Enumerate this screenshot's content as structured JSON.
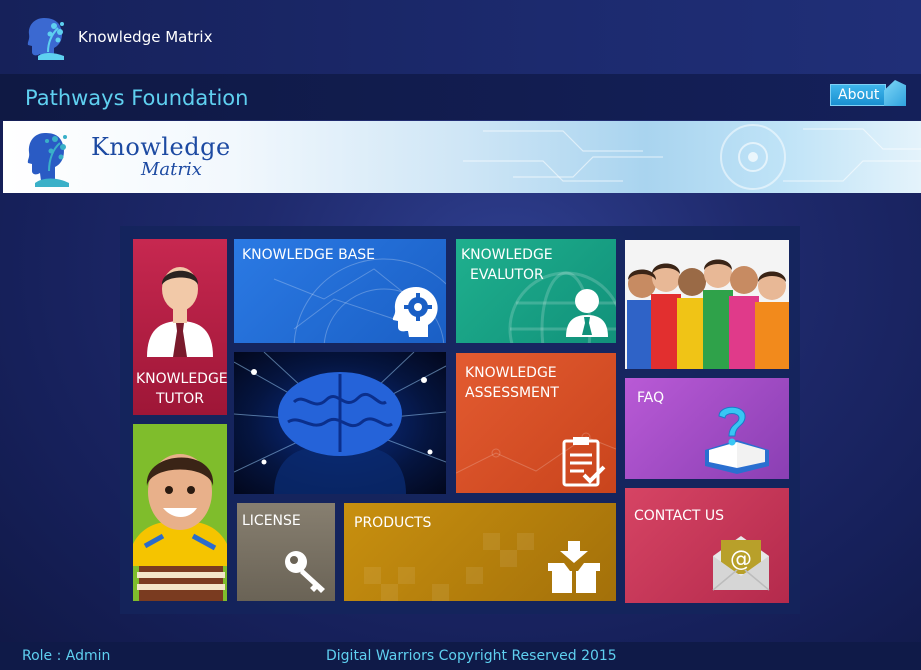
{
  "window": {
    "app_title": "Knowledge Matrix"
  },
  "header": {
    "org_name": "Pathways Foundation",
    "about_label": "About"
  },
  "banner": {
    "logo_word1": "Knowledge",
    "logo_word2": "Matrix"
  },
  "tiles": {
    "tutor": {
      "label_line1": "KNOWLEDGE",
      "label_line2": "TUTOR"
    },
    "base": {
      "label": "KNOWLEDGE BASE"
    },
    "evaluator": {
      "label_line1": "KNOWLEDGE",
      "label_line2": "EVALUTOR"
    },
    "assessment": {
      "label_line1": "KNOWLEDGE",
      "label_line2": "ASSESSMENT"
    },
    "license": {
      "label": "LICENSE"
    },
    "products": {
      "label": "PRODUCTS"
    },
    "faq": {
      "label": "FAQ"
    },
    "contact": {
      "label": "CONTACT US"
    }
  },
  "footer": {
    "role": "Role : Admin",
    "copyright": "Digital Warriors Copyright Reserved 2015"
  },
  "icons": {
    "app_logo": "head-tree-logo-icon",
    "base": "head-gear-icon",
    "evaluator": "person-icon",
    "assessment": "clipboard-check-icon",
    "license": "key-icon",
    "products": "box-download-icon",
    "faq": "question-book-icon",
    "contact": "envelope-at-icon"
  },
  "colors": {
    "accent_text": "#5fd0f0",
    "tutor": "#c72850",
    "base": "#2b7ae4",
    "evaluator": "#1fb08e",
    "assessment": "#e35b31",
    "license": "#877f70",
    "products": "#c8900f",
    "faq": "#b95ad6",
    "contact": "#d64464"
  }
}
